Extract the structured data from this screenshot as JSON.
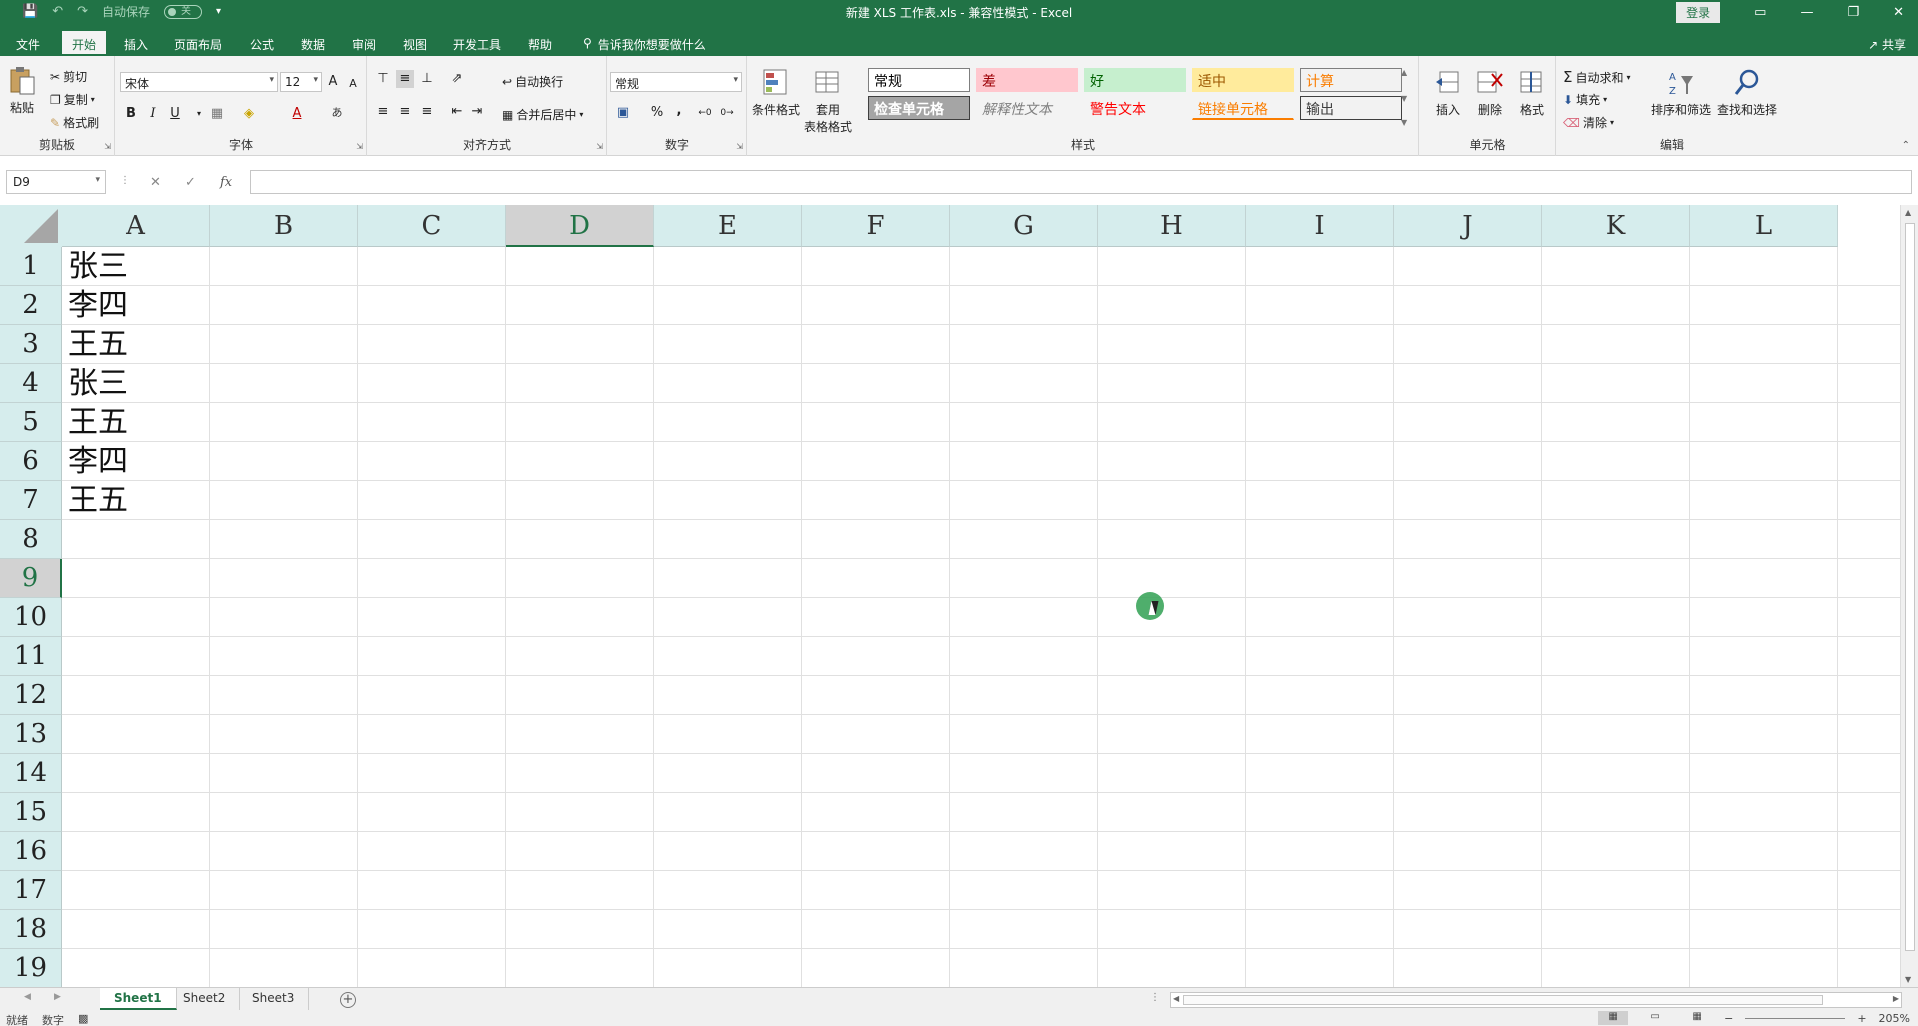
{
  "titlebar": {
    "autosave_label": "自动保存",
    "autosave_state": "关",
    "title": "新建 XLS 工作表.xls  -  兼容性模式  -  Excel",
    "login_label": "登录"
  },
  "menu": {
    "tabs": [
      "文件",
      "开始",
      "插入",
      "页面布局",
      "公式",
      "数据",
      "审阅",
      "视图",
      "开发工具",
      "帮助"
    ],
    "active": "开始",
    "tellme": "告诉我你想要做什么",
    "share": "共享"
  },
  "ribbon": {
    "clipboard": {
      "label": "剪贴板",
      "paste": "粘贴",
      "cut": "剪切",
      "copy": "复制",
      "format_painter": "格式刷"
    },
    "font": {
      "label": "字体",
      "font_name": "宋体",
      "font_size": "12",
      "bold": "B",
      "italic": "I",
      "underline": "U",
      "grow": "A",
      "shrink": "A"
    },
    "alignment": {
      "label": "对齐方式",
      "wrap": "自动换行",
      "merge": "合并后居中"
    },
    "number": {
      "label": "数字",
      "format": "常规",
      "percent": "%",
      "comma": ","
    },
    "styles": {
      "label": "样式",
      "conditional": "条件格式",
      "table_line1": "套用",
      "table_line2": "表格格式",
      "cells": [
        {
          "text": "常规",
          "bg": "#ffffff",
          "fg": "#000000",
          "border": "#7f7f7f"
        },
        {
          "text": "差",
          "bg": "#ffc7ce",
          "fg": "#9c0006",
          "border": "#ffc7ce"
        },
        {
          "text": "好",
          "bg": "#c6efce",
          "fg": "#006100",
          "border": "#c6efce"
        },
        {
          "text": "适中",
          "bg": "#ffeb9c",
          "fg": "#9c5700",
          "border": "#ffeb9c"
        },
        {
          "text": "计算",
          "bg": "#f2f2f2",
          "fg": "#fa7d00",
          "border": "#7f7f7f"
        },
        {
          "text": "检查单元格",
          "bg": "#a5a5a5",
          "fg": "#ffffff",
          "border": "#3f3f3f"
        },
        {
          "text": "解释性文本",
          "bg": "#f3f3f3",
          "fg": "#7f7f7f",
          "border": "#f3f3f3"
        },
        {
          "text": "警告文本",
          "bg": "#f3f3f3",
          "fg": "#ff0000",
          "border": "#f3f3f3"
        },
        {
          "text": "链接单元格",
          "bg": "#f3f3f3",
          "fg": "#fa7d00",
          "border": "#f3f3f3"
        },
        {
          "text": "输出",
          "bg": "#f2f2f2",
          "fg": "#3f3f3f",
          "border": "#3f3f3f"
        }
      ]
    },
    "cells_group": {
      "label": "单元格",
      "insert": "插入",
      "delete": "删除",
      "format": "格式"
    },
    "editing": {
      "label": "编辑",
      "autosum": "自动求和",
      "fill": "填充",
      "clear": "清除",
      "sort": "排序和筛选",
      "find": "查找和选择"
    }
  },
  "formula_bar": {
    "name_box": "D9",
    "fx": "fx",
    "value": ""
  },
  "grid": {
    "columns": [
      "A",
      "B",
      "C",
      "D",
      "E",
      "F",
      "G",
      "H",
      "I",
      "J",
      "K",
      "L"
    ],
    "rows": [
      "1",
      "2",
      "3",
      "4",
      "5",
      "6",
      "7",
      "8",
      "9",
      "10",
      "11",
      "12",
      "13",
      "14",
      "15",
      "16",
      "17",
      "18",
      "19"
    ],
    "selected_column": "D",
    "selected_row": "9",
    "column_a_values": [
      "张三",
      "李四",
      "王五",
      "张三",
      "王五",
      "李四",
      "王五"
    ]
  },
  "sheets": {
    "tabs": [
      "Sheet1",
      "Sheet2",
      "Sheet3"
    ],
    "active": "Sheet1"
  },
  "statusbar": {
    "ready": "就绪",
    "mode": "数字",
    "zoom": "205%"
  },
  "colors": {
    "accent": "#217346",
    "header_bg": "#d6eded"
  }
}
